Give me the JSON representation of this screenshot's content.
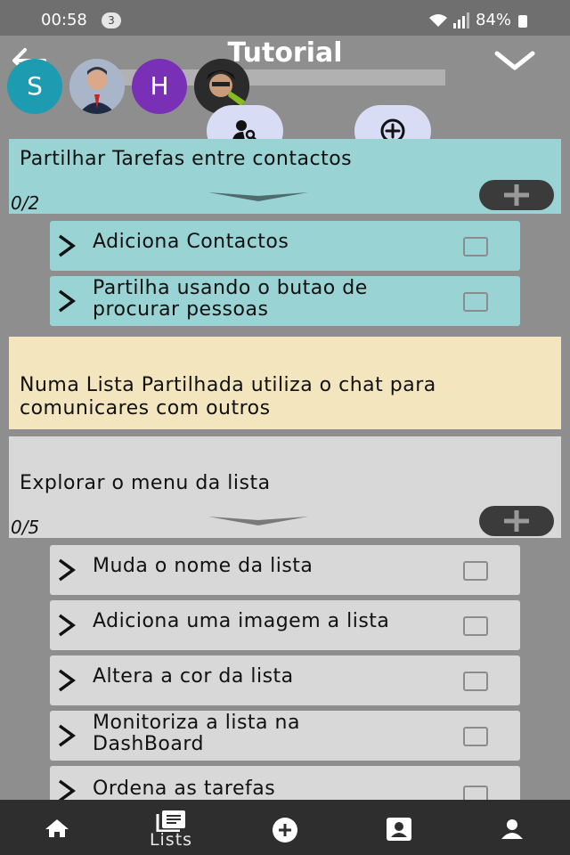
{
  "status_bar": {
    "time": "00:58",
    "notification_count": "3",
    "battery": "84%"
  },
  "header": {
    "title": "Tutorial"
  },
  "avatars": [
    {
      "type": "letter",
      "letter": "S",
      "color": "#1d9bb0"
    },
    {
      "type": "photo"
    },
    {
      "type": "letter",
      "letter": "H",
      "color": "#7a2fb7"
    },
    {
      "type": "photo"
    }
  ],
  "sections": [
    {
      "title": "Partilhar Tarefas entre contactos",
      "counter": "0/2",
      "color": "#99d3d3",
      "tasks": [
        {
          "label": "Adiciona Contactos",
          "checked": false
        },
        {
          "label": "Partilha usando o butao de procurar pessoas",
          "checked": false
        }
      ]
    },
    {
      "title": "Numa Lista Partilhada utiliza o chat para comunicares com outros",
      "color": "#f3e6bf"
    },
    {
      "title": "Explorar o menu da lista",
      "counter": "0/5",
      "color": "#d8d8d8",
      "tasks": [
        {
          "label": "Muda o nome da lista",
          "checked": false
        },
        {
          "label": "Adiciona uma imagem a lista",
          "checked": false
        },
        {
          "label": "Altera a cor da lista",
          "checked": false
        },
        {
          "label": "Monitoriza a lista na DashBoard",
          "checked": false
        },
        {
          "label": "Ordena as tarefas",
          "checked": false
        }
      ]
    }
  ],
  "bottom_nav": [
    {
      "icon": "home-icon"
    },
    {
      "icon": "lists-icon",
      "label": "Lists"
    },
    {
      "icon": "add-circle-icon"
    },
    {
      "icon": "contacts-icon"
    },
    {
      "icon": "profile-icon"
    }
  ]
}
